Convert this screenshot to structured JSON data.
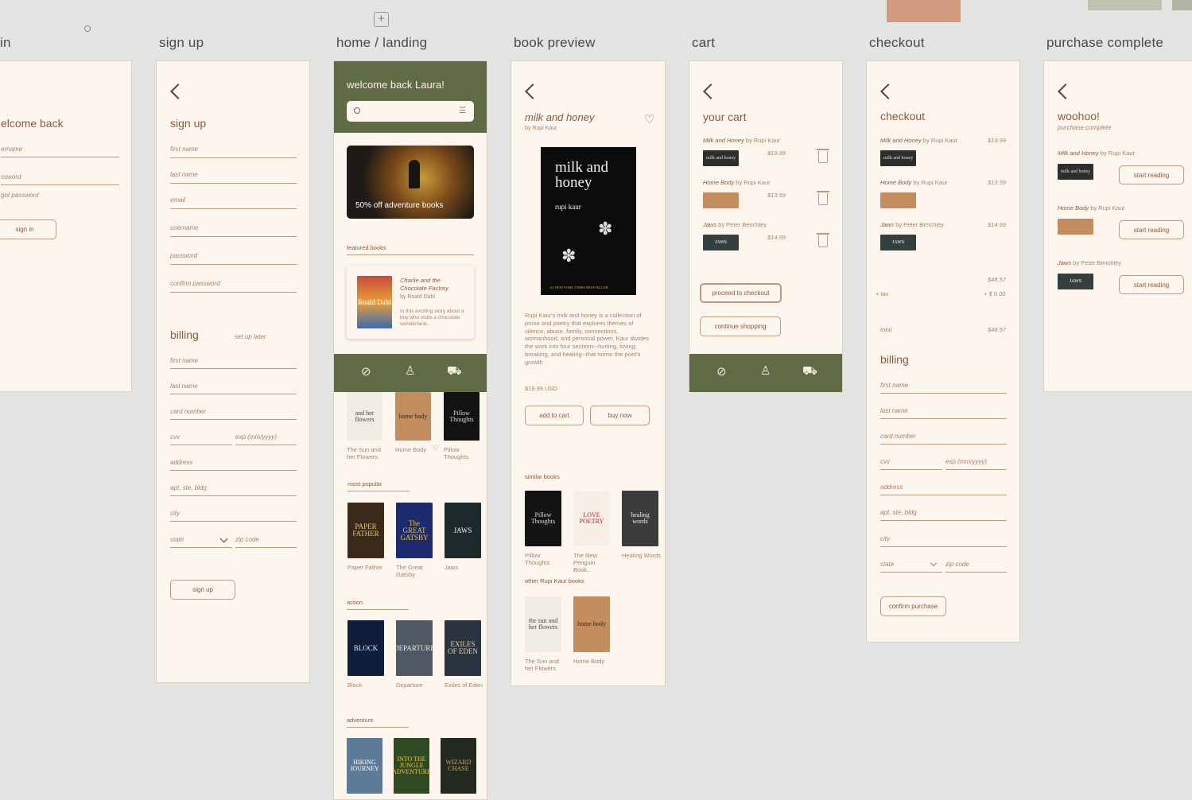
{
  "canvas": {
    "plus_icon": "plus-icon",
    "search_icon": "search-icon"
  },
  "swatches": {
    "colors": [
      "#d49a80",
      "#bfc4b1",
      "#b1b4a2"
    ]
  },
  "frames": {
    "login": {
      "title": "in",
      "heading": "elcome back",
      "username": "ername",
      "password": "ssword",
      "forgot": "got password",
      "signin": "sign in"
    },
    "signup": {
      "title": "sign up",
      "heading": "sign up",
      "first": "first name",
      "last": "last name",
      "email": "email",
      "username": "username",
      "password": "password",
      "confirm": "confirm password",
      "billing": "billing",
      "setup_later": "set up later",
      "b_first": "first name",
      "b_last": "last name",
      "card": "card number",
      "cvv": "cvv",
      "exp": "exp (mm/yyyy)",
      "address": "address",
      "apt": "apt, ste, bldg",
      "city": "city",
      "state": "state",
      "zip": "zip code",
      "button": "sign up"
    },
    "home": {
      "title": "home / landing",
      "welcome": "welcome back Laura!",
      "banner": "50% off adventure books",
      "featured": "featured books",
      "feat_title": "Charlie and the Chocolate Factory",
      "feat_author": "by Roald Dahl",
      "feat_desc": "In this exciting story about a boy who visits a chocolate wonderland..",
      "feat_cover": "Roald Dahl",
      "row1": [
        {
          "label": "The Sun and her Flowers",
          "cover": "and her flowers",
          "color": "#f1ece2",
          "text": "#4a4a4a"
        },
        {
          "label": "Home Body",
          "cover": "home body",
          "color": "#c38d5d",
          "text": "#3a2418"
        },
        {
          "label": "Pillow Thoughts",
          "cover": "Pillow Thoughts",
          "color": "#121212",
          "text": "#dddddd"
        }
      ],
      "popular": "most popular",
      "popular_books": [
        {
          "label": "Paper Father",
          "cover": "PAPER FATHER",
          "color": "#3b2a1a",
          "text": "#e5c27a"
        },
        {
          "label": "The Great Gatsby",
          "cover": "The GREAT GATSBY",
          "color": "#1b2b6e",
          "text": "#f2c340"
        },
        {
          "label": "Jaws",
          "cover": "JAWS",
          "color": "#1d2a2c",
          "text": "#f2f2f2"
        }
      ],
      "action": "action",
      "action_books": [
        {
          "label": "Block",
          "cover": "BLOCK",
          "color": "#0f1c3a",
          "text": "#e8e8e8"
        },
        {
          "label": "Departure",
          "cover": "DEPARTURE",
          "color": "#4e5964",
          "text": "#f0e6d8"
        },
        {
          "label": "Exiles of Eden",
          "cover": "EXILES OF EDEN",
          "color": "#2a3340",
          "text": "#e6d4b8"
        }
      ],
      "adventure": "adventure",
      "adventure_books": [
        {
          "cover": "HIKING JOURNEY",
          "color": "#5d7a96",
          "text": "#ffffff"
        },
        {
          "cover": "INTO THE JUNGLE ADVENTURE",
          "color": "#2f4a22",
          "text": "#f3c23a"
        },
        {
          "cover": "WIZARD CHASE",
          "color": "#232a22",
          "text": "#c8a860"
        }
      ]
    },
    "preview": {
      "title": "book preview",
      "book": "milk and honey",
      "author": "by Rupi Kaur",
      "cover_title": "milk and honey",
      "cover_author": "rupi kaur",
      "cover_tag": "#1 NEW YORK TIMES BESTSELLER",
      "desc": "Rupi Kaur's milk and honey is a collection of prose and poetry that explores themes of silence, abuse, family, connections, womanhood, and personal power. Kaur divides the work into four sections--hurting, loving, breaking, and healing--that mirror the poet's growth",
      "price": "$19.99 USD",
      "add": "add to cart",
      "buy": "buy now",
      "similar": "similar books",
      "similar_books": [
        {
          "label": "Pillow Thoughts",
          "cover": "Pillow Thoughts",
          "color": "#141414",
          "text": "#dddddd"
        },
        {
          "label": "The New Penguin Book..",
          "cover": "LOVE POETRY",
          "color": "#f5efe6",
          "text": "#b0242a"
        },
        {
          "label": "Healing Words",
          "cover": "healing words",
          "color": "#3c3c3c",
          "text": "#eeeeee"
        }
      ],
      "other": "other Rupi Kaur books",
      "other_books": [
        {
          "label": "The Sun and her Flowers",
          "cover": "the sun and her flowers",
          "color": "#f1ece2",
          "text": "#4a4a4a"
        },
        {
          "label": "Home Body",
          "cover": "home body",
          "color": "#c38d5d",
          "text": "#3a2418"
        }
      ]
    },
    "cart": {
      "title": "cart",
      "heading": "your cart",
      "items": [
        {
          "name": "Milk and Honey",
          "author": "by Rupi Kaur",
          "price": "$19.99",
          "cover": "milk and honey",
          "color": "#2e2e2e",
          "text": "#dddddd"
        },
        {
          "name": "Home Body",
          "author": "by Rupi Kaur",
          "price": "$13.59",
          "cover": "",
          "color": "#c38d5d",
          "text": "#3a2418"
        },
        {
          "name": "Jaws",
          "author": "by Peter Benchley",
          "price": "$14.99",
          "cover": "JAWS",
          "color": "#33403f",
          "text": "#ffffff"
        }
      ],
      "proceed": "proceed to checkout",
      "continue": "continue shopping"
    },
    "checkout": {
      "title": "checkout",
      "heading": "checkout",
      "items": [
        {
          "name": "Milk and Honey",
          "author": "by Rupi Kaur",
          "price": "$19.99",
          "cover": "milk and honey",
          "color": "#2e2e2e",
          "text": "#dddddd"
        },
        {
          "name": "Home Body",
          "author": "by Rupi Kaur",
          "price": "$13.59",
          "cover": "",
          "color": "#c38d5d",
          "text": "#3a2418"
        },
        {
          "name": "Jaws",
          "author": "by Peter Benchley",
          "price": "$14.99",
          "cover": "JAWS",
          "color": "#33403f",
          "text": "#ffffff"
        }
      ],
      "subtotal": "$48.57",
      "tax_label": "+ tax",
      "tax": "+ $ 0.00",
      "total_label": "total",
      "total": "$48.57",
      "billing": "billing",
      "first": "first name",
      "last": "last name",
      "card": "card number",
      "cvv": "cvv",
      "exp": "exp (mm/yyyy)",
      "address": "address",
      "apt": "apt, ste, bldg",
      "city": "city",
      "state": "state",
      "zip": "zip code",
      "confirm": "confirm purchase"
    },
    "complete": {
      "title": "purchase complete",
      "heading": "woohoo!",
      "sub": "purchase complete",
      "items": [
        {
          "name": "Milk and Honey",
          "author": "by Rupi Kaur",
          "button": "start reading",
          "cover": "milk and honey",
          "color": "#2e2e2e",
          "text": "#dddddd"
        },
        {
          "name": "Home Body",
          "author": "by Rupi Kaur",
          "button": "start reading",
          "cover": "",
          "color": "#c38d5d",
          "text": "#3a2418"
        },
        {
          "name": "Jaws",
          "author": "by Peter Benchley",
          "button": "start reading",
          "cover": "JAWS",
          "color": "#33403f",
          "text": "#ffffff"
        }
      ]
    }
  }
}
